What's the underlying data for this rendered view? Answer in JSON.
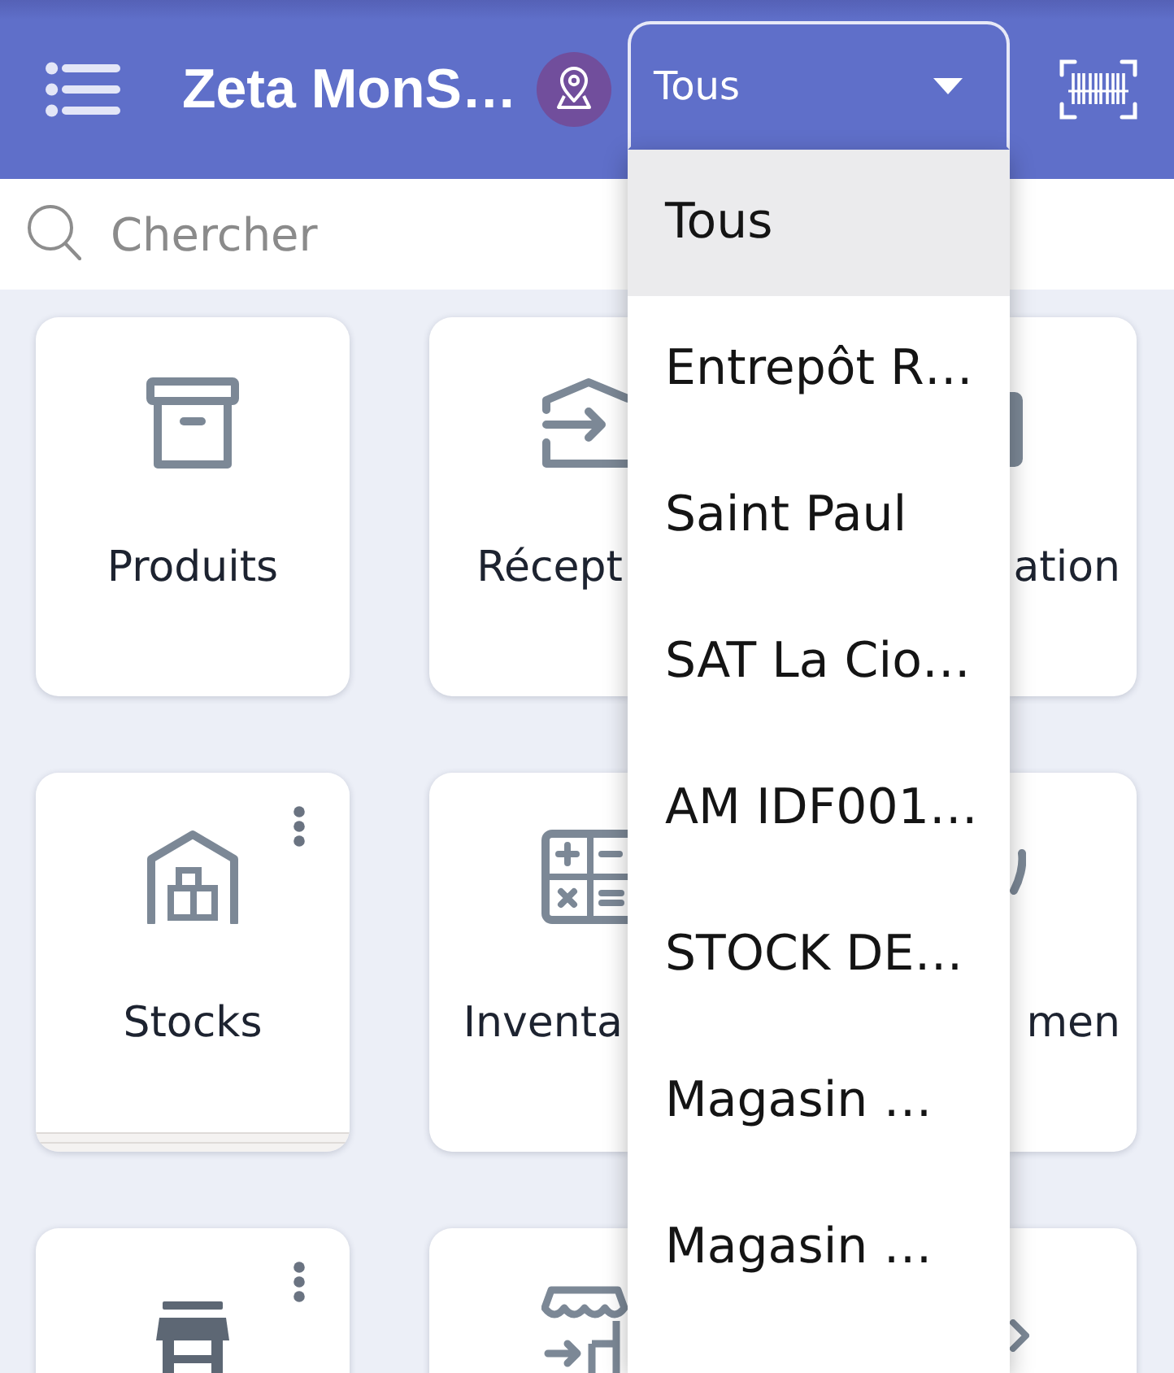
{
  "app_bar": {
    "title": "Zeta MonS…",
    "store_select": {
      "value": "Tous",
      "expanded": true,
      "options": [
        {
          "label": "Tous",
          "selected": true
        },
        {
          "label": "Entrepôt R…",
          "selected": false
        },
        {
          "label": "Saint Paul",
          "selected": false
        },
        {
          "label": "SAT La Cio…",
          "selected": false
        },
        {
          "label": "AM IDF001…",
          "selected": false
        },
        {
          "label": "STOCK DE…",
          "selected": false
        },
        {
          "label": "Magasin …",
          "selected": false
        },
        {
          "label": "Magasin …",
          "selected": false
        }
      ]
    }
  },
  "search": {
    "placeholder": "Chercher"
  },
  "tiles": [
    {
      "label": "Produits",
      "menu": false,
      "stacked": false
    },
    {
      "label": "Récept",
      "menu": false,
      "stacked": false
    },
    {
      "label": "ation",
      "menu": false,
      "stacked": false
    },
    {
      "label": "Stocks",
      "menu": true,
      "stacked": true
    },
    {
      "label": "Inventa",
      "menu": false,
      "stacked": false
    },
    {
      "label": "men",
      "menu": false,
      "stacked": false
    },
    {
      "menu": true
    },
    {
      "menu": false
    },
    {
      "menu": false
    }
  ]
}
